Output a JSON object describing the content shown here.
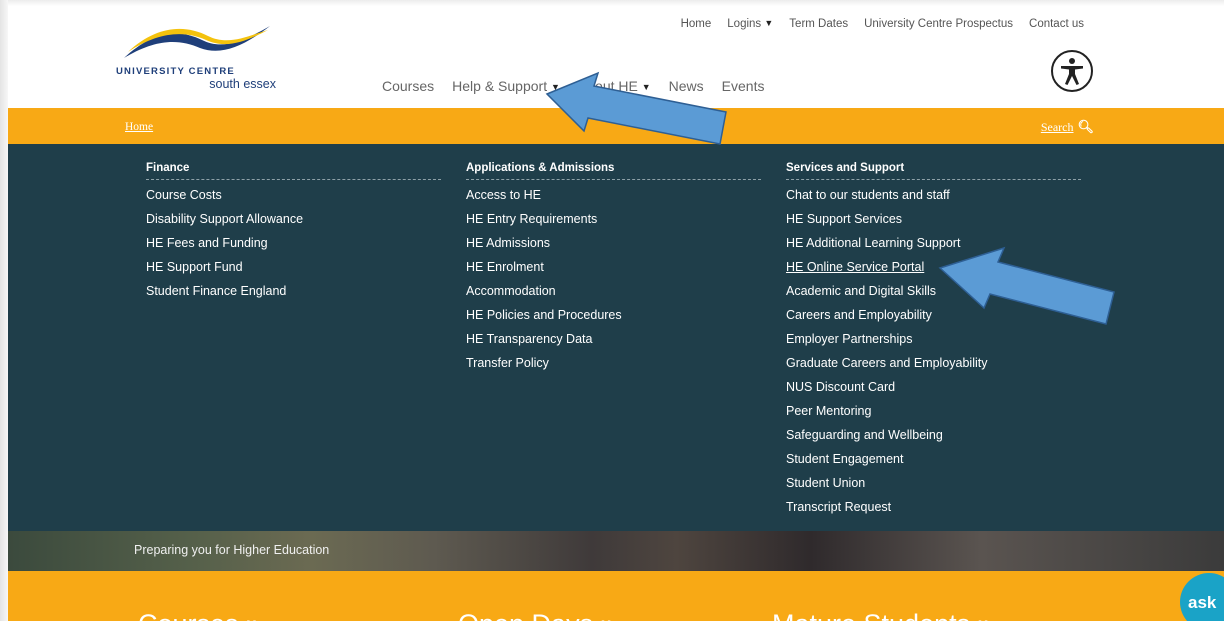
{
  "header": {
    "logo": {
      "line1": "UNIVERSITY CENTRE",
      "line2": "south essex"
    },
    "util_nav": [
      "Home",
      "Logins",
      "Term Dates",
      "University Centre Prospectus",
      "Contact us"
    ],
    "main_nav": {
      "courses": "Courses",
      "help": "Help & Support",
      "about": "About HE",
      "news": "News",
      "events": "Events"
    },
    "caret": "▼"
  },
  "breadcrumb": {
    "home": "Home",
    "search": "Search",
    "search_icon": "magnifier-icon"
  },
  "mega_menu": {
    "finance": {
      "heading": "Finance",
      "items": [
        "Course Costs",
        "Disability Support Allowance",
        "HE Fees and Funding",
        "HE Support Fund",
        "Student Finance England"
      ]
    },
    "admissions": {
      "heading": "Applications & Admissions",
      "items": [
        "Access to HE",
        "HE Entry Requirements",
        "HE Admissions",
        "HE Enrolment",
        "Accommodation",
        "HE Policies and Procedures",
        "HE Transparency Data",
        "Transfer Policy"
      ]
    },
    "services": {
      "heading": "Services and Support",
      "items": [
        "Chat to our students and staff",
        "HE Support Services",
        "HE Additional Learning Support",
        "HE Online Service Portal",
        "Academic and Digital Skills",
        "Careers and Employability",
        "Employer Partnerships",
        "Graduate Careers and Employability",
        "NUS Discount Card",
        "Peer Mentoring",
        "Safeguarding and Wellbeing",
        "Student Engagement",
        "Student Union",
        "Transcript Request"
      ]
    }
  },
  "hero": {
    "tagline": "Preparing you for Higher Education"
  },
  "bottom_links": [
    "Courses »",
    "Open Days »",
    "Mature Students »"
  ],
  "chat_widget": {
    "label": "ask"
  },
  "colors": {
    "accent_orange": "#f8a915",
    "menu_bg": "#1f3e4a",
    "brand_blue": "#1f3f7a",
    "arrow_blue": "#5b9bd5"
  }
}
